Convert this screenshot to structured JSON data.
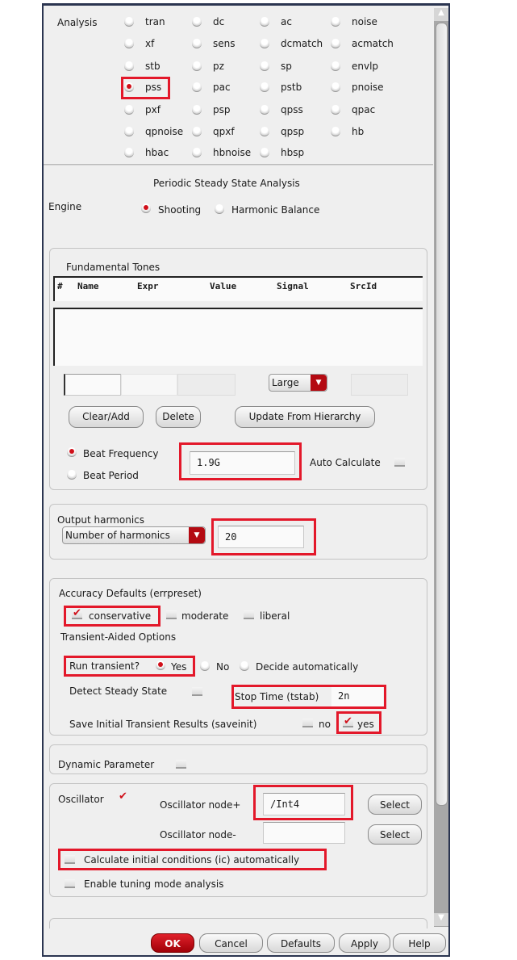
{
  "analysis": {
    "label": "Analysis",
    "selected": "pss",
    "options": [
      [
        "tran",
        "dc",
        "ac",
        "noise"
      ],
      [
        "xf",
        "sens",
        "dcmatch",
        "acmatch"
      ],
      [
        "stb",
        "pz",
        "sp",
        "envlp"
      ],
      [
        "pss",
        "pac",
        "pstb",
        "pnoise"
      ],
      [
        "pxf",
        "psp",
        "qpss",
        "qpac"
      ],
      [
        "qpnoise",
        "qpxf",
        "qpsp",
        "hb"
      ],
      [
        "hbac",
        "hbnoise",
        "hbsp"
      ]
    ]
  },
  "pss": {
    "title": "Periodic Steady State Analysis",
    "engine": {
      "label": "Engine",
      "shooting": "Shooting",
      "hb": "Harmonic Balance",
      "selected": "Shooting"
    },
    "tones": {
      "title": "Fundamental Tones",
      "columns": [
        "#",
        "Name",
        "Expr",
        "Value",
        "Signal",
        "SrcId"
      ],
      "rows": [],
      "size_select": "Large",
      "clear_add": "Clear/Add",
      "delete": "Delete",
      "update": "Update From Hierarchy"
    },
    "beat": {
      "freq_label": "Beat Frequency",
      "period_label": "Beat Period",
      "selected": "Beat Frequency",
      "value": "1.9G",
      "auto_calc": "Auto Calculate",
      "auto_calc_checked": false
    },
    "harmonics": {
      "title": "Output harmonics",
      "mode": "Number of harmonics",
      "value": "20"
    },
    "accuracy": {
      "title": "Accuracy Defaults (errpreset)",
      "conservative": "conservative",
      "moderate": "moderate",
      "liberal": "liberal",
      "selected": "conservative"
    },
    "transient": {
      "title": "Transient-Aided Options",
      "run_label": "Run transient?",
      "yes": "Yes",
      "no": "No",
      "auto": "Decide automatically",
      "selected": "Yes",
      "detect": "Detect Steady State",
      "detect_checked": false,
      "stop_label": "Stop Time (tstab)",
      "stop_value": "2n",
      "save_label": "Save Initial Transient Results (saveinit)",
      "save_no": "no",
      "save_yes": "yes",
      "save_selected": "yes"
    },
    "dynamic": {
      "label": "Dynamic Parameter",
      "checked": false
    },
    "osc": {
      "label": "Oscillator",
      "checked": true,
      "node_plus_label": "Oscillator node+",
      "node_plus": "/Int4",
      "node_minus_label": "Oscillator node-",
      "node_minus": "",
      "select": "Select",
      "calc_ic": "Calculate initial conditions (ic) automatically",
      "calc_ic_checked": false,
      "tuning": "Enable tuning mode analysis",
      "tuning_checked": false
    }
  },
  "footer": {
    "ok": "OK",
    "cancel": "Cancel",
    "defaults": "Defaults",
    "apply": "Apply",
    "help": "Help"
  },
  "colors": {
    "accent": "#d0101a",
    "highlight": "#e3182a",
    "frame": "#2b3550"
  }
}
